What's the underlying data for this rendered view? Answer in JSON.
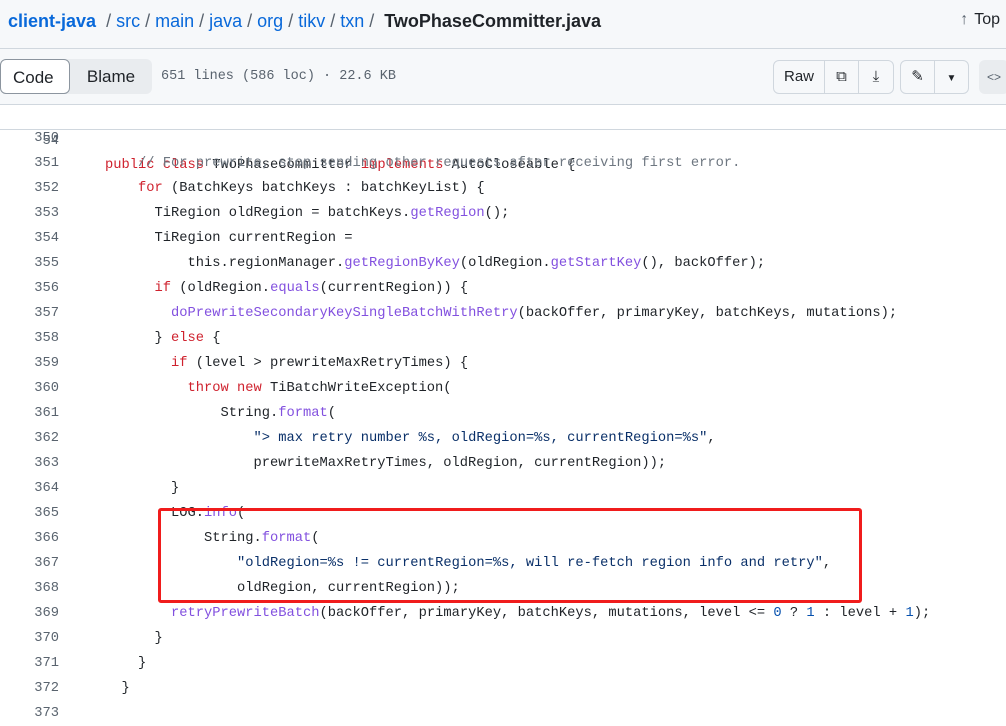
{
  "breadcrumb": {
    "repo": "client-java",
    "parts": [
      "src",
      "main",
      "java",
      "org",
      "tikv",
      "txn"
    ],
    "file": "TwoPhaseCommitter.java",
    "separator": "/"
  },
  "top_link": {
    "icon": "arrow-up-icon",
    "label": "Top"
  },
  "toolbar": {
    "code_tab": "Code",
    "blame_tab": "Blame",
    "meta": "651 lines (586 loc) · 22.6 KB",
    "raw_label": "Raw"
  },
  "sticky": {
    "line": "54",
    "tokens": [
      [
        "k",
        "public class "
      ],
      [
        "p",
        "TwoPhaseCommitter "
      ],
      [
        "k",
        "implements "
      ],
      [
        "p",
        "AutoCloseable {"
      ]
    ]
  },
  "lines": [
    {
      "n": "350",
      "t": []
    },
    {
      "n": "351",
      "t": [
        [
          "p",
          "    "
        ],
        [
          "c",
          "// For prewrite, stop sending other requests after receiving first error."
        ]
      ]
    },
    {
      "n": "352",
      "t": [
        [
          "p",
          "    "
        ],
        [
          "k",
          "for"
        ],
        [
          "p",
          " (BatchKeys batchKeys : batchKeyList) {"
        ]
      ]
    },
    {
      "n": "353",
      "t": [
        [
          "p",
          "      TiRegion oldRegion = batchKeys."
        ],
        [
          "f",
          "getRegion"
        ],
        [
          "p",
          "();"
        ]
      ]
    },
    {
      "n": "354",
      "t": [
        [
          "p",
          "      TiRegion currentRegion ="
        ]
      ]
    },
    {
      "n": "355",
      "t": [
        [
          "p",
          "          this.regionManager."
        ],
        [
          "f",
          "getRegionByKey"
        ],
        [
          "p",
          "(oldRegion."
        ],
        [
          "f",
          "getStartKey"
        ],
        [
          "p",
          "(), backOffer);"
        ]
      ]
    },
    {
      "n": "356",
      "t": [
        [
          "p",
          "      "
        ],
        [
          "k",
          "if"
        ],
        [
          "p",
          " (oldRegion."
        ],
        [
          "f",
          "equals"
        ],
        [
          "p",
          "(currentRegion)) {"
        ]
      ]
    },
    {
      "n": "357",
      "t": [
        [
          "p",
          "        "
        ],
        [
          "f",
          "doPrewriteSecondaryKeySingleBatchWithRetry"
        ],
        [
          "p",
          "(backOffer, primaryKey, batchKeys, mutations);"
        ]
      ]
    },
    {
      "n": "358",
      "t": [
        [
          "p",
          "      } "
        ],
        [
          "k",
          "else"
        ],
        [
          "p",
          " {"
        ]
      ]
    },
    {
      "n": "359",
      "t": [
        [
          "p",
          "        "
        ],
        [
          "k",
          "if"
        ],
        [
          "p",
          " (level > prewriteMaxRetryTimes) {"
        ]
      ]
    },
    {
      "n": "360",
      "t": [
        [
          "p",
          "          "
        ],
        [
          "k",
          "throw new"
        ],
        [
          "p",
          " TiBatchWriteException("
        ]
      ]
    },
    {
      "n": "361",
      "t": [
        [
          "p",
          "              String."
        ],
        [
          "f",
          "format"
        ],
        [
          "p",
          "("
        ]
      ]
    },
    {
      "n": "362",
      "t": [
        [
          "p",
          "                  "
        ],
        [
          "s",
          "\"> max retry number %s, oldRegion=%s, currentRegion=%s\""
        ],
        [
          "p",
          ","
        ]
      ]
    },
    {
      "n": "363",
      "t": [
        [
          "p",
          "                  prewriteMaxRetryTimes, oldRegion, currentRegion));"
        ]
      ]
    },
    {
      "n": "364",
      "t": [
        [
          "p",
          "        }"
        ]
      ]
    },
    {
      "n": "365",
      "t": [
        [
          "p",
          "        LOG."
        ],
        [
          "f",
          "info"
        ],
        [
          "p",
          "("
        ]
      ]
    },
    {
      "n": "366",
      "t": [
        [
          "p",
          "            String."
        ],
        [
          "f",
          "format"
        ],
        [
          "p",
          "("
        ]
      ]
    },
    {
      "n": "367",
      "t": [
        [
          "p",
          "                "
        ],
        [
          "s",
          "\"oldRegion=%s != currentRegion=%s, will re-fetch region info and retry\""
        ],
        [
          "p",
          ","
        ]
      ]
    },
    {
      "n": "368",
      "t": [
        [
          "p",
          "                oldRegion, currentRegion));"
        ]
      ]
    },
    {
      "n": "369",
      "t": [
        [
          "p",
          "        "
        ],
        [
          "f",
          "retryPrewriteBatch"
        ],
        [
          "p",
          "(backOffer, primaryKey, batchKeys, mutations, level <= "
        ],
        [
          "n",
          "0"
        ],
        [
          "p",
          " ? "
        ],
        [
          "n",
          "1"
        ],
        [
          "p",
          " : level + "
        ],
        [
          "n",
          "1"
        ],
        [
          "p",
          ");"
        ]
      ]
    },
    {
      "n": "370",
      "t": [
        [
          "p",
          "      }"
        ]
      ]
    },
    {
      "n": "371",
      "t": [
        [
          "p",
          "    }"
        ]
      ]
    },
    {
      "n": "372",
      "t": [
        [
          "p",
          "  }"
        ]
      ]
    },
    {
      "n": "373",
      "t": []
    }
  ]
}
